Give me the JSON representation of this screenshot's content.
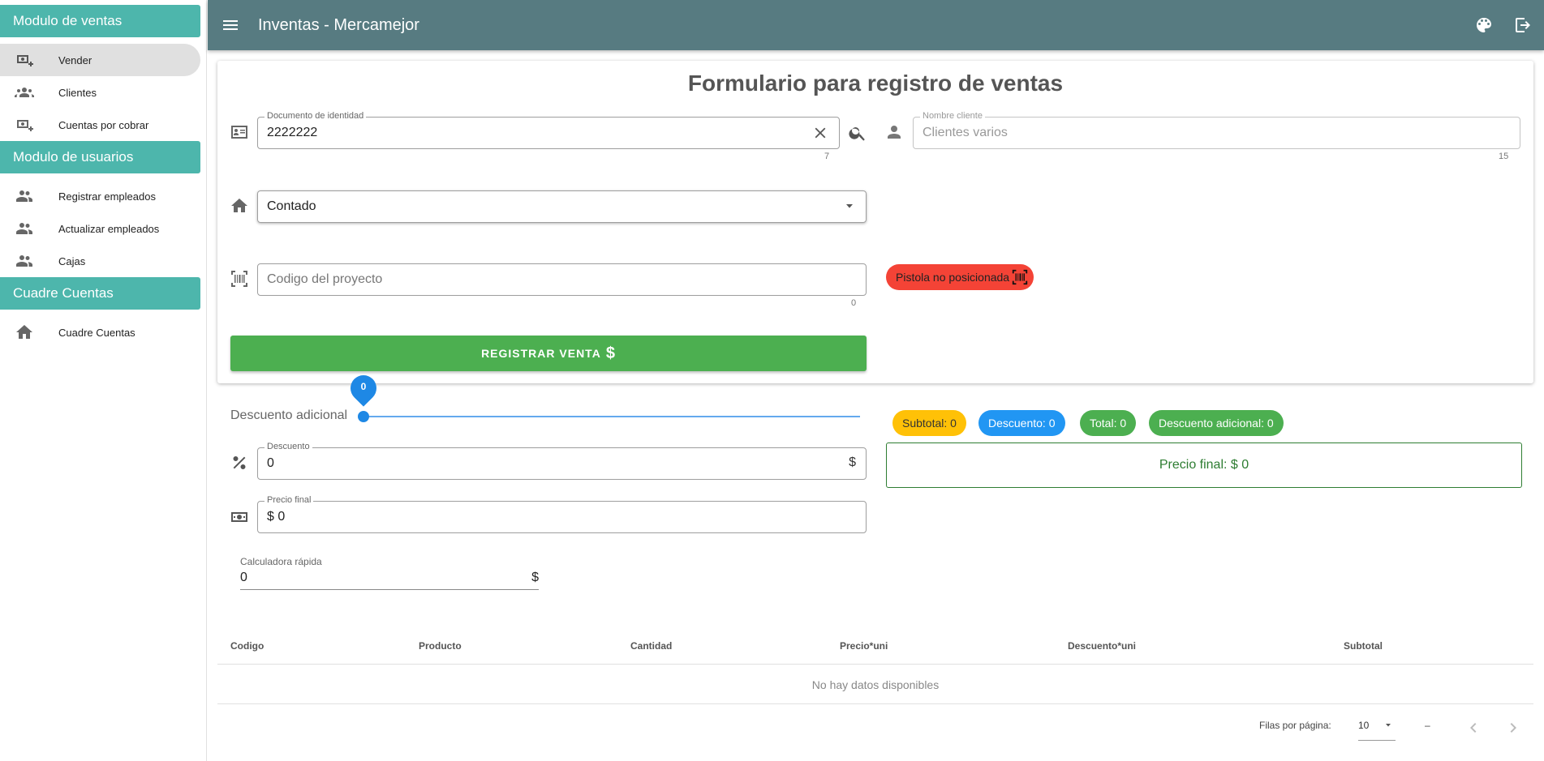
{
  "sidebar": {
    "sections": [
      {
        "title": "Modulo de ventas"
      },
      {
        "title": "Modulo de usuarios"
      },
      {
        "title": "Cuadre Cuentas"
      }
    ],
    "items": [
      {
        "label": "Vender",
        "icon": "cash-plus-icon"
      },
      {
        "label": "Clientes",
        "icon": "account-group-icon"
      },
      {
        "label": "Cuentas por cobrar",
        "icon": "cash-plus-icon"
      },
      {
        "label": "Registrar empleados",
        "icon": "people-icon"
      },
      {
        "label": "Actualizar empleados",
        "icon": "people-icon"
      },
      {
        "label": "Cajas",
        "icon": "people-icon"
      },
      {
        "label": "Cuadre Cuentas",
        "icon": "home-icon"
      }
    ]
  },
  "header": {
    "title": "Inventas - Mercamejor"
  },
  "form": {
    "title": "Formulario para registro de ventas",
    "documento": {
      "label": "Documento de identidad",
      "value": "2222222",
      "counter": "7"
    },
    "cliente": {
      "label": "Nombre cliente",
      "placeholder": "Clientes varios",
      "counter": "15"
    },
    "pago": {
      "value": "Contado"
    },
    "codigo": {
      "placeholder": "Codigo del proyecto",
      "counter": "0"
    },
    "pistola": "Pistola no posicionada",
    "register_button": "REGISTRAR VENTA",
    "register_icon": "$"
  },
  "descuento_adicional": {
    "label": "Descuento adicional",
    "value": "0"
  },
  "descuento": {
    "label": "Descuento",
    "value": "0",
    "suffix": "$"
  },
  "precio_final": {
    "label": "Precio final",
    "value": "$ 0"
  },
  "calculadora": {
    "label": "Calculadora rápida",
    "value": "0",
    "suffix": "$"
  },
  "chips": {
    "subtotal": "Subtotal: 0",
    "descuento": "Descuento: 0",
    "total": "Total: 0",
    "descuento_adicional": "Descuento adicional: 0"
  },
  "final_box": "Precio final: $ 0",
  "table": {
    "headers": [
      "Codigo",
      "Producto",
      "Cantidad",
      "Precio*uni",
      "Descuento*uni",
      "Subtotal"
    ],
    "empty": "No hay datos disponibles"
  },
  "pagination": {
    "rows_label": "Filas por página:",
    "rows_value": "10",
    "range": "–"
  },
  "colors": {
    "topbar": "#577b81",
    "section": "#4db6ac",
    "register": "#4caf50",
    "pistola": "#f44336"
  }
}
